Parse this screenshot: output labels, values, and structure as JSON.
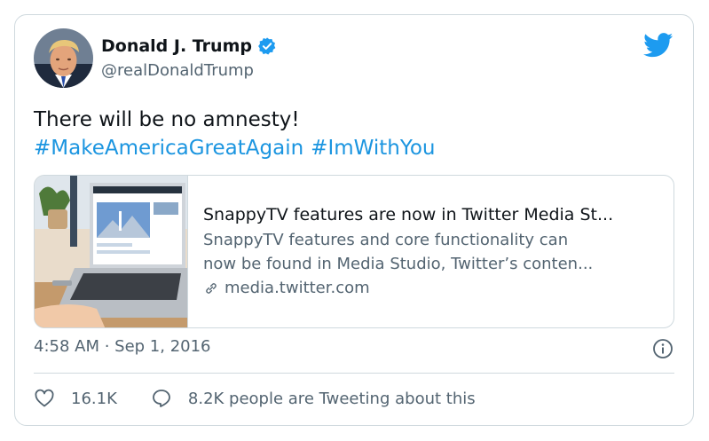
{
  "user": {
    "name": "Donald J. Trump",
    "handle": "@realDonaldTrump"
  },
  "tweet": {
    "text": "There will be no amnesty!",
    "hashtags": [
      "#MakeAmericaGreatAgain",
      "#ImWithYou"
    ]
  },
  "link_card": {
    "title": "SnappyTV features are now in Twitter Media St...",
    "description_line1": "SnappyTV features and core functionality can",
    "description_line2": "now be found in Media Studio, Twitter’s conten...",
    "domain": "media.twitter.com"
  },
  "meta": {
    "timestamp": "4:58 AM · Sep 1, 2016"
  },
  "actions": {
    "likes": "16.1K",
    "replies_text": "8.2K people are Tweeting about this"
  },
  "colors": {
    "accent": "#1d9bf0",
    "hashtag": "#1b95e0",
    "muted": "#536471",
    "border": "#cfd9de"
  },
  "icons": [
    "verified-badge-icon",
    "twitter-bird-icon",
    "link-icon",
    "info-icon",
    "heart-icon",
    "speech-bubble-icon"
  ]
}
